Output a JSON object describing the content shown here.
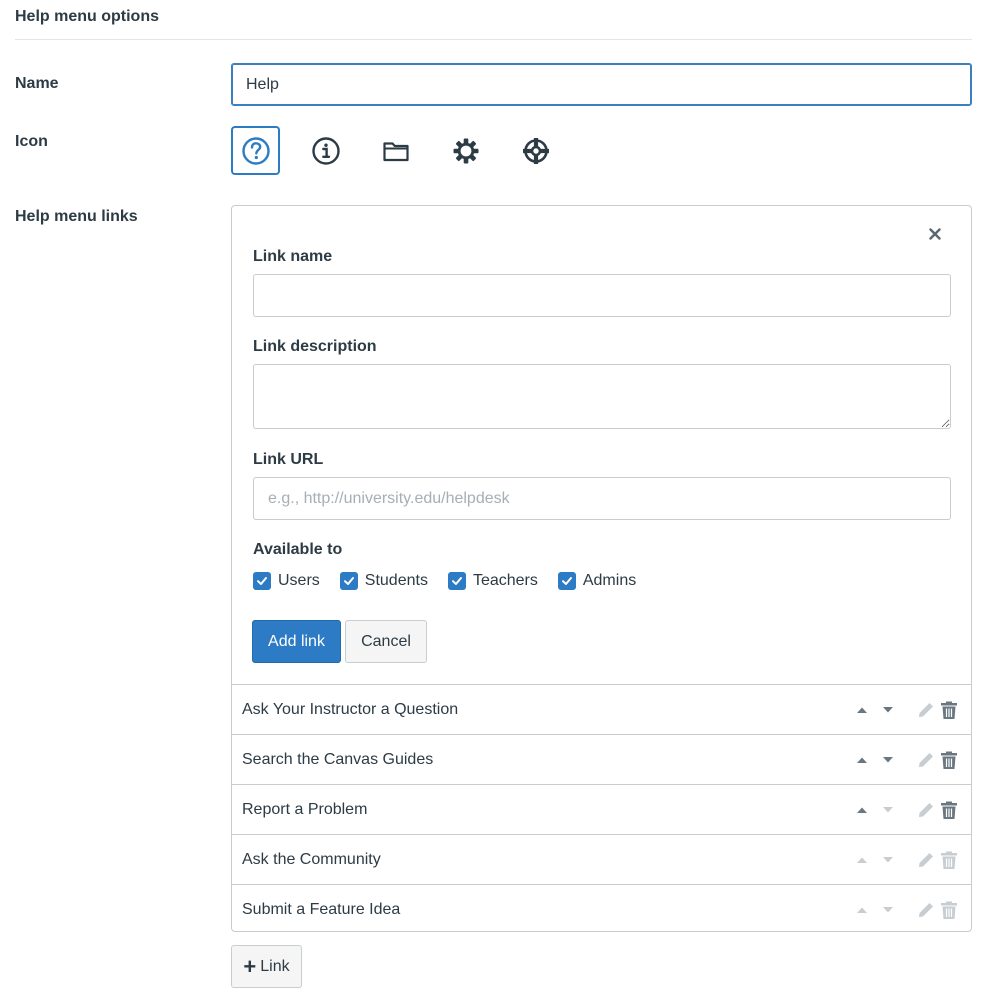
{
  "section": {
    "title": "Help menu options"
  },
  "name_field": {
    "label": "Name",
    "value": "Help"
  },
  "icon_field": {
    "label": "Icon",
    "options": [
      {
        "icon": "question-circle-icon",
        "selected": true
      },
      {
        "icon": "info-circle-icon",
        "selected": false
      },
      {
        "icon": "folder-icon",
        "selected": false
      },
      {
        "icon": "gear-icon",
        "selected": false
      },
      {
        "icon": "lifesaver-icon",
        "selected": false
      }
    ]
  },
  "links_section": {
    "label": "Help menu links",
    "form": {
      "close_glyph": "×",
      "link_name_label": "Link name",
      "link_name_value": "",
      "link_description_label": "Link description",
      "link_description_value": "",
      "link_url_label": "Link URL",
      "link_url_placeholder": "e.g., http://university.edu/helpdesk",
      "available_label": "Available to",
      "roles": [
        {
          "label": "Users",
          "checked": true
        },
        {
          "label": "Students",
          "checked": true
        },
        {
          "label": "Teachers",
          "checked": true
        },
        {
          "label": "Admins",
          "checked": true
        }
      ],
      "add_button": "Add link",
      "cancel_button": "Cancel"
    },
    "links": [
      {
        "name": "Ask Your Instructor a Question",
        "up_enabled": true,
        "down_enabled": true,
        "edit_enabled": false,
        "delete_enabled": true
      },
      {
        "name": "Search the Canvas Guides",
        "up_enabled": true,
        "down_enabled": true,
        "edit_enabled": false,
        "delete_enabled": true
      },
      {
        "name": "Report a Problem",
        "up_enabled": true,
        "down_enabled": false,
        "edit_enabled": false,
        "delete_enabled": true
      },
      {
        "name": "Ask the Community",
        "up_enabled": false,
        "down_enabled": false,
        "edit_enabled": false,
        "delete_enabled": false
      },
      {
        "name": "Submit a Feature Idea",
        "up_enabled": false,
        "down_enabled": false,
        "edit_enabled": false,
        "delete_enabled": false
      }
    ],
    "add_link_button": "Link"
  },
  "colors": {
    "primary": "#2d7bc4",
    "text": "#2d3b45",
    "enabled_icon": "#6b7780",
    "disabled_icon": "#c7cdd1"
  }
}
